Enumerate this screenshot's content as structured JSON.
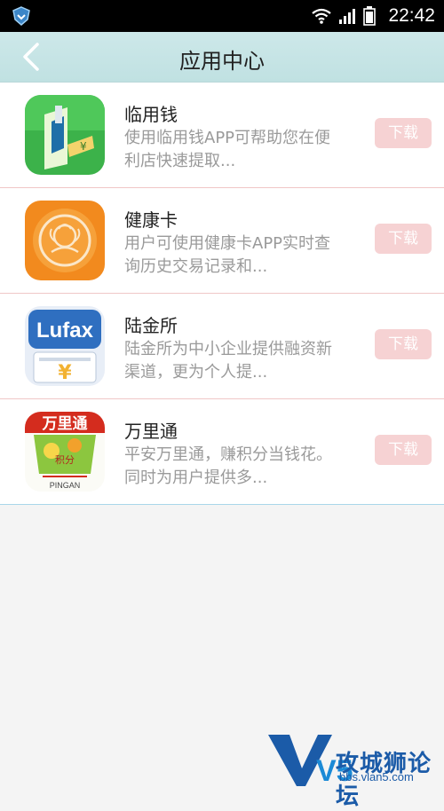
{
  "status_bar": {
    "time": "22:42"
  },
  "header": {
    "title": "应用中心"
  },
  "apps": [
    {
      "name": "临用钱",
      "description": "使用临用钱APP可帮助您在便利店快速提取...",
      "download_label": "下载",
      "icon": "money-atm-icon"
    },
    {
      "name": "健康卡",
      "description": "用户可使用健康卡APP实时查询历史交易记录和...",
      "download_label": "下载",
      "icon": "health-card-icon"
    },
    {
      "name": "陆金所",
      "description": "陆金所为中小企业提供融资新渠道，更为个人提...",
      "download_label": "下载",
      "icon": "lufax-icon",
      "icon_text": "Lufax"
    },
    {
      "name": "万里通",
      "description": "平安万里通，赚积分当钱花。同时为用户提供多...",
      "download_label": "下载",
      "icon": "wanlitong-icon",
      "icon_text": "万里通",
      "icon_sub": "积分",
      "icon_brand": "PINGAN"
    }
  ],
  "watermark": {
    "text": "攻城狮论坛",
    "url": "bbs.vlan5.com",
    "logo": "V5"
  },
  "colors": {
    "appbar": "#c6e4e5",
    "download_button": "#f6d2d3",
    "divider": "#f0c7c7"
  }
}
